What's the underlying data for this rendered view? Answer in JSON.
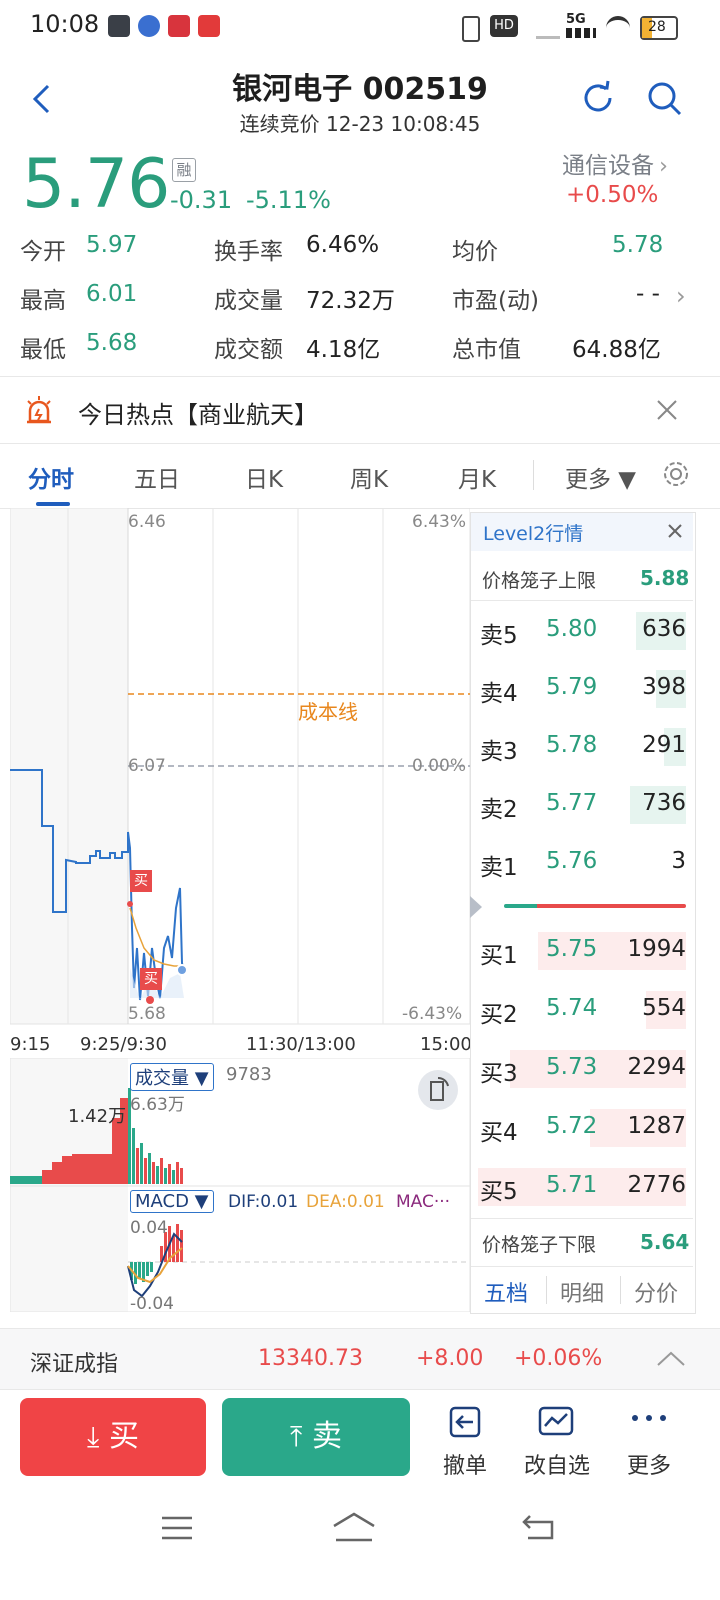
{
  "status_bar": {
    "time": "10:08",
    "battery": "28",
    "network": "5G"
  },
  "header": {
    "title": "银河电子 002519",
    "subtitle": "连续竞价 12-23 10:08:45"
  },
  "quote": {
    "price": "5.76",
    "rong": "融",
    "change": "-0.31",
    "change_pct": "-5.11%",
    "sector": "通信设备",
    "sector_change": "+0.50%"
  },
  "stats": {
    "open_label": "今开",
    "open": "5.97",
    "turnover_rate_label": "换手率",
    "turnover_rate": "6.46%",
    "avg_label": "均价",
    "avg": "5.78",
    "high_label": "最高",
    "high": "6.01",
    "volume_label": "成交量",
    "volume": "72.32万",
    "pe_label": "市盈(动)",
    "pe": "- -",
    "low_label": "最低",
    "low": "5.68",
    "amount_label": "成交额",
    "amount": "4.18亿",
    "mcap_label": "总市值",
    "mcap": "64.88亿"
  },
  "hotspot": {
    "text": "今日热点【商业航天】"
  },
  "tabs": [
    "分时",
    "五日",
    "日K",
    "周K",
    "月K",
    "更多 ▼"
  ],
  "chart": {
    "price_high": "6.46",
    "price_mid": "6.07",
    "price_low": "5.68",
    "pct_high": "6.43%",
    "pct_mid": "0.00%",
    "pct_low": "-6.43%",
    "cost_line_label": "成本线",
    "buy_marker": "买",
    "time_labels": [
      "9:15",
      "9:25/9:30",
      "11:30/13:00",
      "15:00"
    ],
    "volume_indicator": "成交量 ▼",
    "volume_value": "9783",
    "volume_max": "6.63万",
    "volume_left": "1.42万",
    "macd_indicator": "MACD ▼",
    "dif": "DIF:0.01",
    "dea": "DEA:0.01",
    "macd_more": "MAC···",
    "macd_top": "0.04",
    "macd_bottom": "-0.04"
  },
  "order_book": {
    "title": "Level2行情",
    "upper_limit_label": "价格笼子上限",
    "upper_limit": "5.88",
    "asks": [
      {
        "label": "卖5",
        "price": "5.80",
        "vol": "636"
      },
      {
        "label": "卖4",
        "price": "5.79",
        "vol": "398"
      },
      {
        "label": "卖3",
        "price": "5.78",
        "vol": "291"
      },
      {
        "label": "卖2",
        "price": "5.77",
        "vol": "736"
      },
      {
        "label": "卖1",
        "price": "5.76",
        "vol": "3"
      }
    ],
    "bids": [
      {
        "label": "买1",
        "price": "5.75",
        "vol": "1994"
      },
      {
        "label": "买2",
        "price": "5.74",
        "vol": "554"
      },
      {
        "label": "买3",
        "price": "5.73",
        "vol": "2294"
      },
      {
        "label": "买4",
        "price": "5.72",
        "vol": "1287"
      },
      {
        "label": "买5",
        "price": "5.71",
        "vol": "2776"
      }
    ],
    "lower_limit_label": "价格笼子下限",
    "lower_limit": "5.64",
    "tabs": [
      "五档",
      "明细",
      "分价"
    ]
  },
  "index_bar": {
    "name": "深证成指",
    "value": "13340.73",
    "change": "+8.00",
    "change_pct": "+0.06%"
  },
  "actions": {
    "buy": "买",
    "sell": "卖",
    "cancel": "撤单",
    "watchlist": "改自选",
    "more": "更多"
  },
  "colors": {
    "up": "#e84b4b",
    "down": "#2a9d7c",
    "accent": "#1f5dbd",
    "cost_line": "#e8871e"
  }
}
